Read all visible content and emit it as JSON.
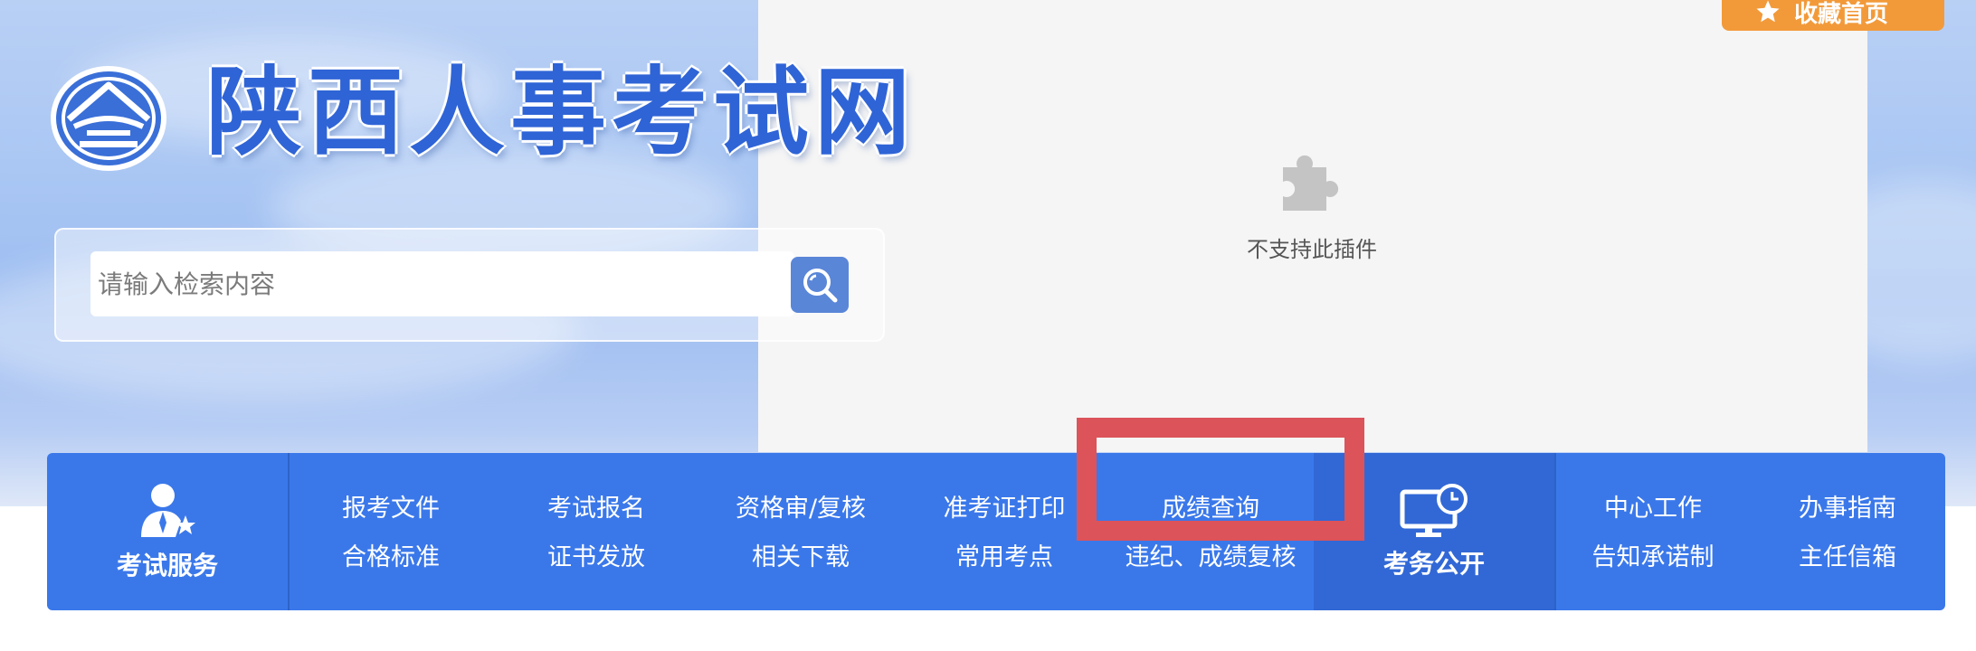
{
  "header": {
    "site_title": "陕西人事考试网",
    "bookmark_label": "收藏首页",
    "bookmark_icon": "star-icon"
  },
  "plugin": {
    "message": "不支持此插件",
    "icon": "puzzle-piece-icon"
  },
  "search": {
    "placeholder": "请输入检索内容",
    "value": "",
    "button_icon": "search-icon"
  },
  "nav": {
    "exam_service": {
      "label": "考试服务",
      "icon": "user-star-icon",
      "links_row1": [
        "报考文件",
        "考试报名",
        "资格审/复核",
        "准考证打印",
        "成绩查询"
      ],
      "links_row2": [
        "合格标准",
        "证书发放",
        "相关下载",
        "常用考点",
        "违纪、成绩复核"
      ]
    },
    "exam_affairs": {
      "label": "考务公开",
      "icon": "monitor-clock-icon",
      "links_row1": [
        "中心工作",
        "办事指南"
      ],
      "links_row2": [
        "告知承诺制",
        "主任信箱"
      ]
    }
  },
  "colors": {
    "nav_blue": "#3a78ea",
    "accent_orange": "#f29a3a",
    "highlight_red": "#dc535a",
    "title_blue": "#2f64d6"
  }
}
